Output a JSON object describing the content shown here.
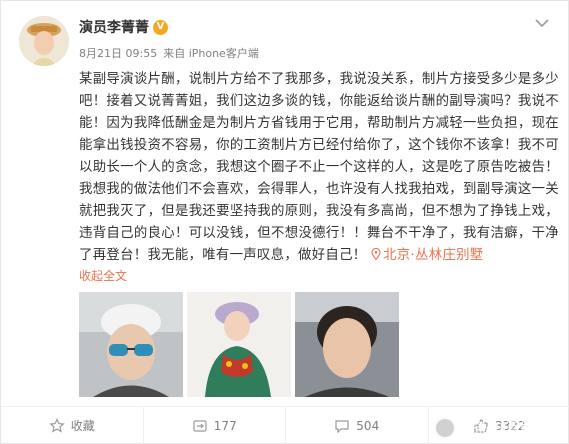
{
  "post": {
    "author": "演员李菁菁",
    "verified_badge": "V",
    "date": "8月21日 09:55",
    "source": "来自 iPhone客户端",
    "body": "某副导演谈片酬，说制片方给不了我那多，我说没关系，制片方接受多少是多少吧！接着又说菁菁姐，我们这边多谈的钱，你能返给谈片酬的副导演吗？我说不能！因为我降低酬金是为制片方省钱用于它用，帮助制片方减轻一些负担，现在能拿出钱投资不容易，你的工资制片方已经付给你了，这个钱你不该拿！我不可以助长一个人的贪念，我想这个圈子不止一个这样的人，这是吃了原告吃被告！我想我的做法他们不会喜欢，会得罪人，也许没有人找我拍戏，到副导演这一关就把我灭了，但是我还要坚持我的原则，我没有多高尚，但不想为了挣钱上戏，违背自己的良心！可以没钱，但不想没德行！！舞台不干净了，我有洁癖，干净了再登台！我无能，唯有一声叹息，做好自己！",
    "location": "北京·丛林庄别墅",
    "collapse_label": "收起全文",
    "colors": {
      "accent": "#eb7350",
      "badge": "#f5a623",
      "meta": "#808080"
    },
    "images": [
      {
        "icon": "selfie-sunglasses-photo"
      },
      {
        "icon": "portrait-costume-photo"
      },
      {
        "icon": "selfie-car-photo"
      }
    ]
  },
  "actions": {
    "favorite_label": "收藏",
    "repost_count": "177",
    "comment_count": "504",
    "like_count": "3322"
  },
  "watermark": {
    "text": "头条 @百姓情怀"
  }
}
